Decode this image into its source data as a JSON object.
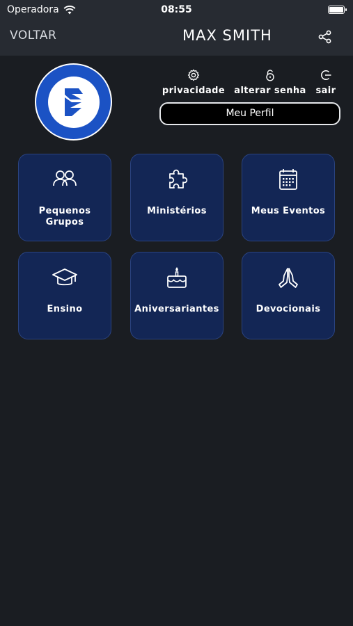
{
  "status_bar": {
    "carrier": "Operadora",
    "time": "08:55"
  },
  "nav": {
    "back_label": "VOLTAR",
    "title": "MAX SMITH"
  },
  "profile": {
    "actions": [
      {
        "label": "privacidade",
        "icon": "gear-icon"
      },
      {
        "label": "alterar senha",
        "icon": "lock-icon"
      },
      {
        "label": "sair",
        "icon": "logout-icon"
      }
    ],
    "profile_button": "Meu Perfil"
  },
  "tiles": [
    {
      "label": "Pequenos Grupos",
      "icon": "group-icon"
    },
    {
      "label": "Ministérios",
      "icon": "puzzle-icon"
    },
    {
      "label": "Meus Eventos",
      "icon": "calendar-icon"
    },
    {
      "label": "Ensino",
      "icon": "graduation-cap-icon"
    },
    {
      "label": "Aniversariantes",
      "icon": "birthday-cake-icon"
    },
    {
      "label": "Devocionais",
      "icon": "praying-hands-icon"
    }
  ],
  "colors": {
    "background": "#1a1d22",
    "header": "#272b32",
    "tile": "#132655",
    "avatar": "#1b52c4"
  }
}
